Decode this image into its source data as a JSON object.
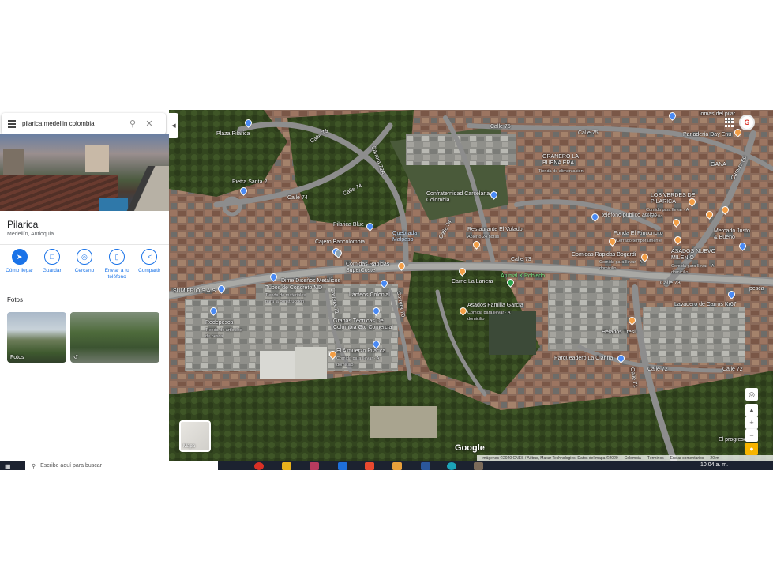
{
  "search": {
    "value": "pilarica medellin colombia"
  },
  "place": {
    "title": "Pilarica",
    "subtitle": "Medellín, Antioquia"
  },
  "actions": [
    {
      "label": "Cómo llegar",
      "icon": "directions-icon"
    },
    {
      "label": "Guardar",
      "icon": "bookmark-icon"
    },
    {
      "label": "Cercano",
      "icon": "nearby-icon"
    },
    {
      "label": "Enviar a tu teléfono",
      "icon": "send-to-phone-icon"
    },
    {
      "label": "Compartir",
      "icon": "share-icon"
    }
  ],
  "photos": {
    "title": "Fotos",
    "items": [
      {
        "caption": "Fotos"
      },
      {
        "caption": ""
      }
    ]
  },
  "map": {
    "labels": {
      "plaza_pilarica": "Plaza Pilarica",
      "pietra_santa": "Pietra Santa 2",
      "calle75_a": "Calle 75",
      "calle75_b": "Calle 75",
      "calle75_c": "Calle 75",
      "carrera72a": "Carrera 72A",
      "calle74_a": "Calle 74",
      "calle74_b": "Calle 74",
      "calle74_c": "Calle 74",
      "lomas": "lomas del pilar",
      "panaderia": "Panadería Day Enu",
      "granero": "GRANERO LA BUENA ERA",
      "granero_sub": "Tienda de alimentación",
      "confraternidad": "Confraternidad Carcelaria de Colombia",
      "telefono": "teléfono publico amigo",
      "verdes": "LOS VERDES DE PILARICA",
      "verdes_sub": "Comida para llevar · A domicilio",
      "gana": "GANA",
      "carrera69": "Carrera 69",
      "pilarica_blue": "Pilarica Blue",
      "cajero": "Cajero Bancolombia",
      "quebrada": "Quebrada Malpaso",
      "restaurante": "Restaurante El Volador",
      "restaurante_sub": "Abierto 24 horas",
      "fonda": "Fonda El Rinconcito",
      "fonda_sub": "Cerrado temporalmente",
      "mercado": "Mercado Justo & Bueno",
      "comidas_super": "Comidas Rapidas SuperCoste",
      "comidas_bogardi": "Comidas Rapidas Bogardi",
      "bogardi_sub": "Comida para llevar · A domicilio",
      "asados_nuevo": "ASADOS NUEVO MILENIO",
      "asados_nuevo_sub": "Comida para llevar · A domicilio",
      "calle73_a": "Calle 73",
      "calle73_b": "Calle 73",
      "dime": "Dime Diseños Metalicos",
      "tubos": "Tubos de Concreto MD",
      "tubos_sub": "Tienda de materiales para la construcción",
      "lacteos": "Lácteos Colonial",
      "sumifrio": "SUMIFRIO S.A.S",
      "carne": "Carne La Lanera",
      "animal": "Animal X Robledo",
      "asados_familia": "Asados Familia García",
      "asados_familia_sub": "Comida para llevar · A domicilio",
      "lavadero": "Lavadero de Carros Kr67",
      "pesca": "pesca",
      "carrera71": "Carrera 71",
      "carrera70": "Carrera 70",
      "redepesca": "Redepesca",
      "redepesca_sub": "Tienda de artículos de pesca",
      "grapas": "Grapas Técnicas De Colombia Gtc Comercial",
      "almuerzo": "El Almuerzo Pilarica",
      "almuerzo_sub": "Comida para llevar · A domicilio",
      "helados": "Helados Tresli",
      "parqueadero": "Parqueadero La Clariña",
      "calle72": "Calle 72",
      "calle71": "Calle 71",
      "progreso": "El progreso"
    },
    "layers_label": "Mapa",
    "google": "Google",
    "attribution": [
      "Imágenes ©2020 CNES / Airbus, Maxar Technologies, Datos del mapa ©2020",
      "Colombia",
      "Términos",
      "Enviar comentarios",
      "20 m"
    ]
  },
  "taskbar": {
    "search_placeholder": "Escribe aquí para buscar",
    "clock": "10:04 a. m."
  },
  "colors": {
    "accent": "#1a73e8",
    "pin_blue": "#4a8af4",
    "pin_orange": "#f39e45"
  }
}
